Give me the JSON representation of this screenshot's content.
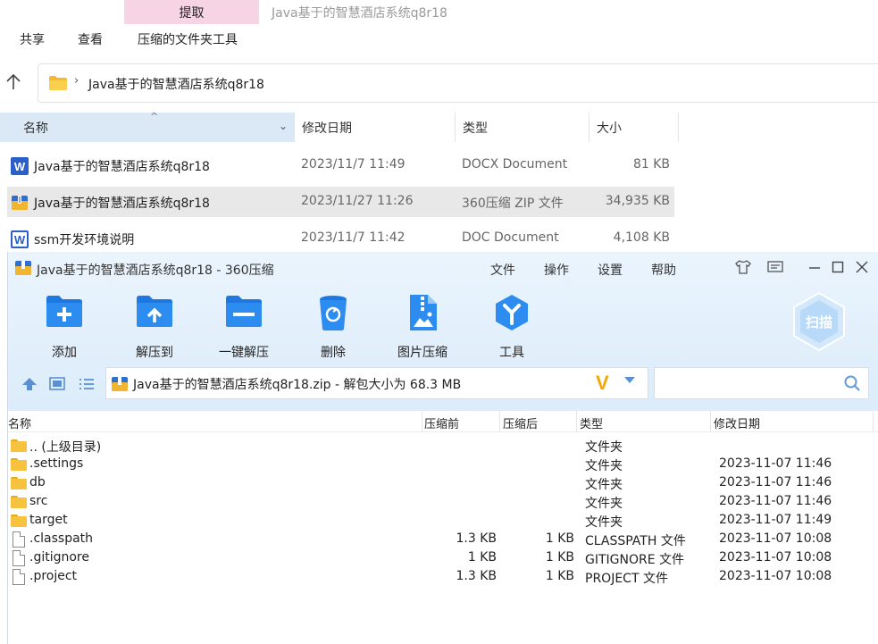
{
  "explorer": {
    "ribbon_tab_active": "提取",
    "window_title": "Java基于的智慧酒店系统q8r18",
    "menu": [
      "共享",
      "查看",
      "压缩的文件夹工具"
    ],
    "address": "Java基于的智慧酒店系统q8r18",
    "columns": {
      "name": "名称",
      "date": "修改日期",
      "type": "类型",
      "size": "大小"
    },
    "files": [
      {
        "name": "Java基于的智慧酒店系统q8r18",
        "date": "2023/11/7 11:49",
        "type": "DOCX Document",
        "size": "81 KB",
        "icon": "word-icon"
      },
      {
        "name": "Java基于的智慧酒店系统q8r18",
        "date": "2023/11/27 11:26",
        "type": "360压缩 ZIP 文件",
        "size": "34,935 KB",
        "icon": "zip-archive-icon"
      },
      {
        "name": "ssm开发环境说明",
        "date": "2023/11/7 11:42",
        "type": "DOC Document",
        "size": "4,108 KB",
        "icon": "word-doc-icon"
      }
    ]
  },
  "zip": {
    "title": "Java基于的智慧酒店系统q8r18 - 360压缩",
    "menu": [
      "文件",
      "操作",
      "设置",
      "帮助"
    ],
    "toolbar": [
      "添加",
      "解压到",
      "一键解压",
      "删除",
      "图片压缩",
      "工具"
    ],
    "scan_label": "扫描",
    "path_text": "Java基于的智慧酒店系统q8r18.zip - 解包大小为 68.3 MB",
    "path_badge": "V",
    "search_placeholder": "",
    "columns": {
      "name": "名称",
      "before": "压缩前",
      "after": "压缩后",
      "type": "类型",
      "modified": "修改日期"
    },
    "entries": [
      {
        "name": ".. (上级目录)",
        "before": "",
        "after": "",
        "type": "文件夹",
        "modified": "",
        "kind": "folder"
      },
      {
        "name": ".settings",
        "before": "",
        "after": "",
        "type": "文件夹",
        "modified": "2023-11-07 11:46",
        "kind": "folder"
      },
      {
        "name": "db",
        "before": "",
        "after": "",
        "type": "文件夹",
        "modified": "2023-11-07 11:46",
        "kind": "folder"
      },
      {
        "name": "src",
        "before": "",
        "after": "",
        "type": "文件夹",
        "modified": "2023-11-07 11:46",
        "kind": "folder"
      },
      {
        "name": "target",
        "before": "",
        "after": "",
        "type": "文件夹",
        "modified": "2023-11-07 11:49",
        "kind": "folder"
      },
      {
        "name": ".classpath",
        "before": "1.3 KB",
        "after": "1 KB",
        "type": "CLASSPATH 文件",
        "modified": "2023-11-07 10:08",
        "kind": "file"
      },
      {
        "name": ".gitignore",
        "before": "1 KB",
        "after": "1 KB",
        "type": "GITIGNORE 文件",
        "modified": "2023-11-07 10:08",
        "kind": "file"
      },
      {
        "name": ".project",
        "before": "1.3 KB",
        "after": "1 KB",
        "type": "PROJECT 文件",
        "modified": "2023-11-07 10:08",
        "kind": "file"
      }
    ]
  }
}
